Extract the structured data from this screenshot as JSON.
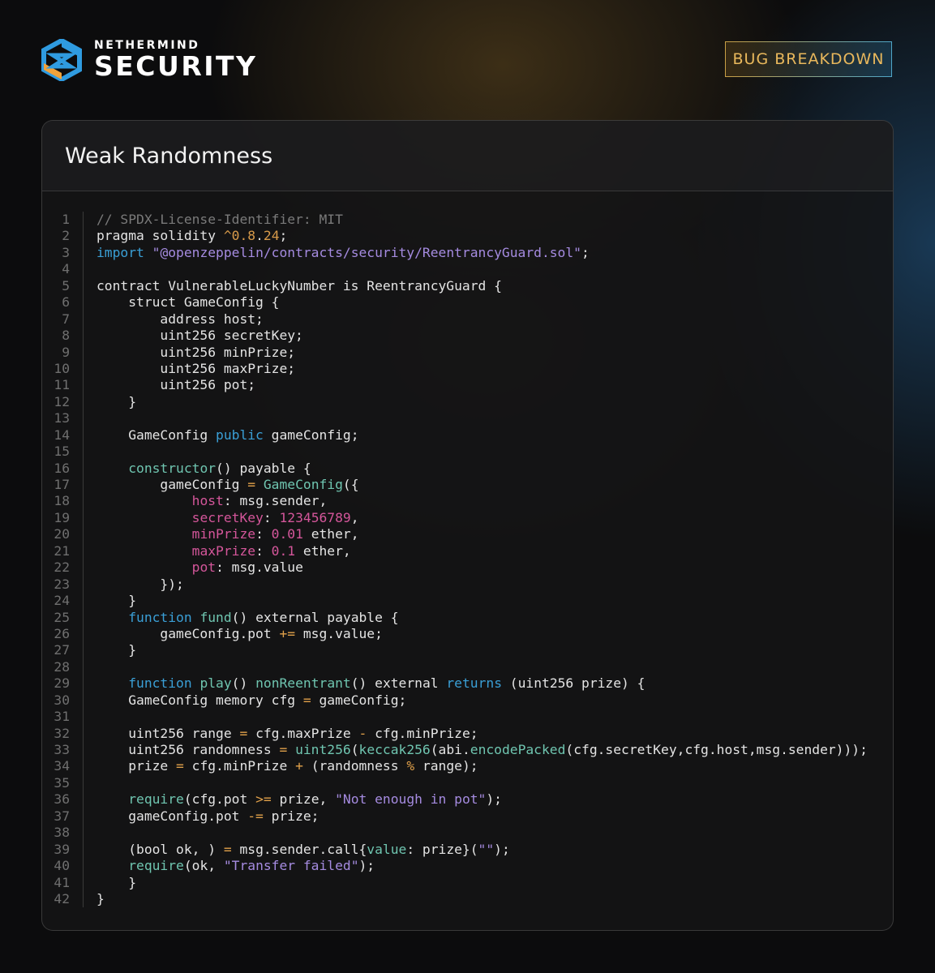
{
  "brand": {
    "top": "NETHERMIND",
    "main": "SECURITY"
  },
  "badge": "BUG BREAKDOWN",
  "card_title": "Weak Randomness",
  "code_lines": [
    "// SPDX-License-Identifier: MIT",
    "pragma solidity ^0.8.24;",
    "import \"@openzeppelin/contracts/security/ReentrancyGuard.sol\";",
    "",
    "contract VulnerableLuckyNumber is ReentrancyGuard {",
    "    struct GameConfig {",
    "        address host;",
    "        uint256 secretKey;",
    "        uint256 minPrize;",
    "        uint256 maxPrize;",
    "        uint256 pot;",
    "    }",
    "",
    "    GameConfig public gameConfig;",
    "",
    "    constructor() payable {",
    "        gameConfig = GameConfig({",
    "            host: msg.sender,",
    "            secretKey: 123456789,",
    "            minPrize: 0.01 ether,",
    "            maxPrize: 0.1 ether,",
    "            pot: msg.value",
    "        });",
    "    }",
    "    function fund() external payable {",
    "        gameConfig.pot += msg.value;",
    "    }",
    "",
    "    function play() nonReentrant() external returns (uint256 prize) {",
    "    GameConfig memory cfg = gameConfig;",
    "",
    "    uint256 range = cfg.maxPrize - cfg.minPrize;",
    "    uint256 randomness = uint256(keccak256(abi.encodePacked(cfg.secretKey,cfg.host,msg.sender)));",
    "    prize = cfg.minPrize + (randomness % range);",
    "",
    "    require(cfg.pot >= prize, \"Not enough in pot\");",
    "    gameConfig.pot -= prize;",
    "",
    "    (bool ok, ) = msg.sender.call{value: prize}(\"\");",
    "    require(ok, \"Transfer failed\");",
    "    }",
    "}"
  ]
}
